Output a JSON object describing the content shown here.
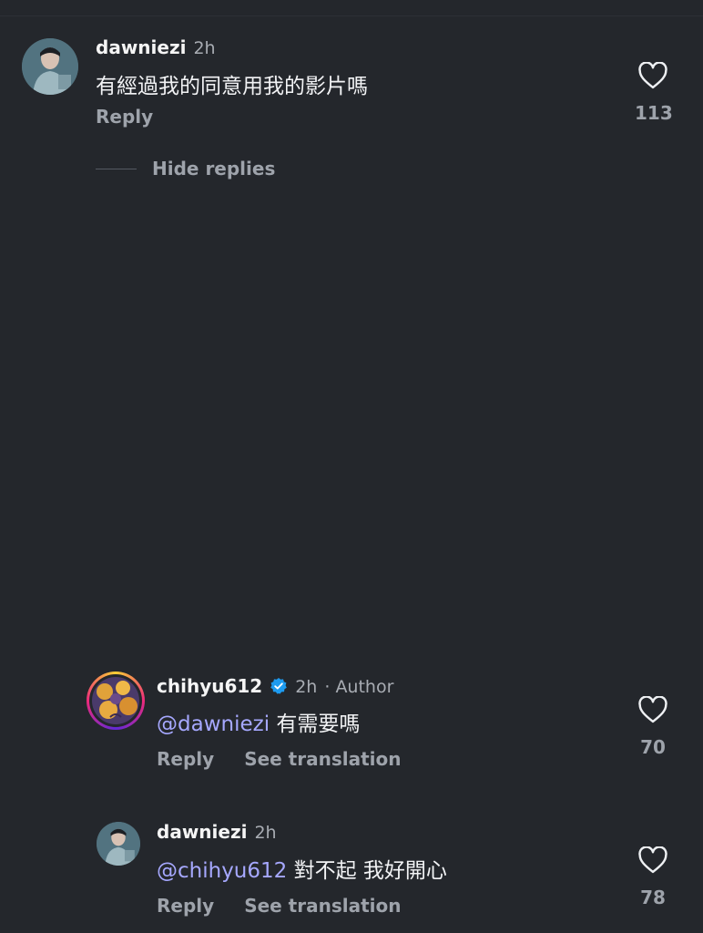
{
  "comments": [
    {
      "username": "dawniezi",
      "time": "2h",
      "text": "有經過我的同意用我的影片嗎",
      "reply_label": "Reply",
      "like_count": "113"
    },
    {
      "username": "chihyu612",
      "time": "2h",
      "author_tag": "· Author",
      "mention": "@dawniezi",
      "text": "有需要嗎",
      "reply_label": "Reply",
      "translate_label": "See translation",
      "like_count": "70",
      "verified": true
    },
    {
      "username": "dawniezi",
      "time": "2h",
      "mention": "@chihyu612",
      "text": "對不起 我好開心",
      "reply_label": "Reply",
      "translate_label": "See translation",
      "like_count": "78"
    }
  ],
  "hide_replies_label": "Hide replies",
  "colors": {
    "background": "#24272c",
    "mention": "#a6a8ff",
    "verified": "#1d9bf0",
    "secondary_text": "#9ea3ab"
  },
  "icons": [
    "heart-outline-icon",
    "verified-badge-icon"
  ]
}
